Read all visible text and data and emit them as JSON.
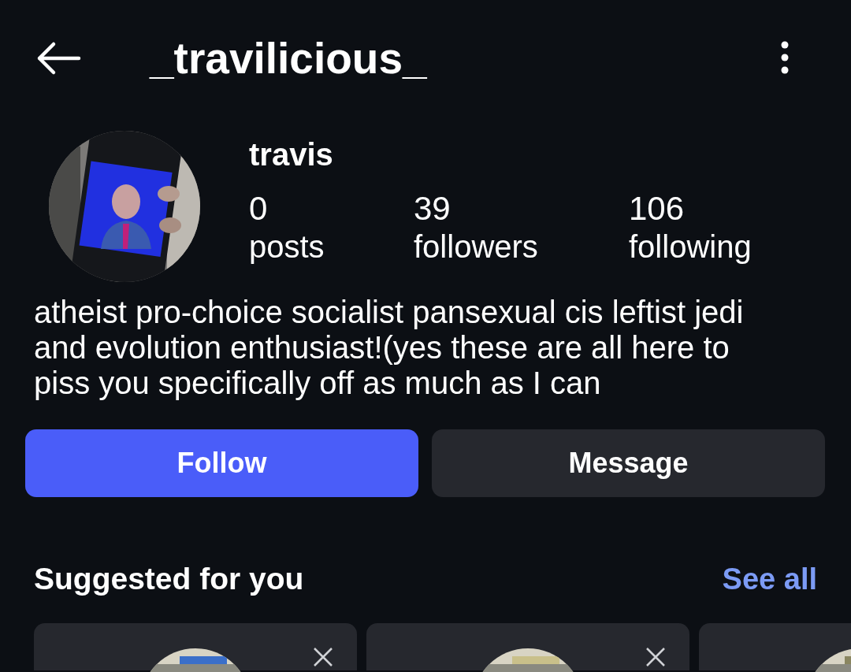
{
  "header": {
    "title": "_travilicious_"
  },
  "profile": {
    "name": "travis",
    "stats": [
      {
        "value": "0",
        "label": "posts"
      },
      {
        "value": "39",
        "label": "followers"
      },
      {
        "value": "106",
        "label": "following"
      }
    ],
    "bio": "atheist pro-choice socialist pansexual cis leftist jedi and evolution enthusiast!(yes these are all here to piss you specifically off as much as I can"
  },
  "actions": [
    {
      "label": "Follow",
      "kind": "primary"
    },
    {
      "label": "Message",
      "kind": "secondary"
    }
  ],
  "suggested": {
    "title": "Suggested for you",
    "link": "See all",
    "cards": [
      {
        "kind": "account"
      },
      {
        "kind": "account"
      },
      {
        "kind": "account"
      }
    ]
  }
}
